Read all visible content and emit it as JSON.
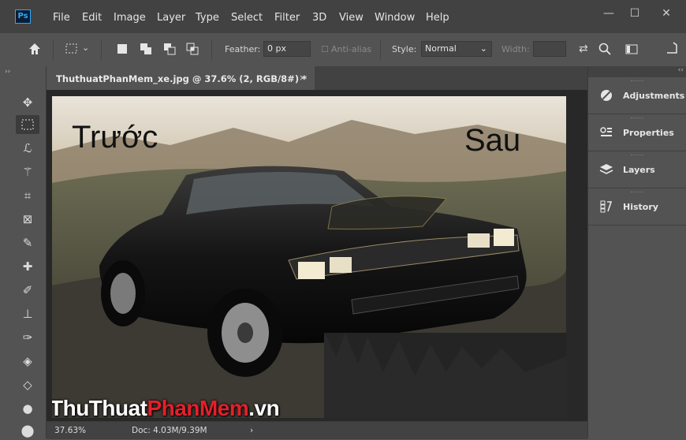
{
  "app": {
    "logo": "Ps"
  },
  "menu": [
    "File",
    "Edit",
    "Image",
    "Layer",
    "Type",
    "Select",
    "Filter",
    "3D",
    "View",
    "Window",
    "Help"
  ],
  "window_controls": {
    "minimize": "—",
    "restore": "☐",
    "close": "✕"
  },
  "options_bar": {
    "feather_label": "Feather:",
    "feather_value": "0 px",
    "antialias_label": "Anti-alias",
    "style_label": "Style:",
    "style_value": "Normal",
    "width_label": "Width:"
  },
  "document": {
    "tab_title": "ThuthuatPhanMem_xe.jpg @ 37.6% (2, RGB/8#) *",
    "close": "×"
  },
  "canvas": {
    "label_before": "Trước",
    "label_after": "Sau",
    "watermark_part1": "ThuThuat",
    "watermark_part2": "PhanMem",
    "watermark_part3": ".vn"
  },
  "status": {
    "zoom": "37.63%",
    "doc_size": "Doc: 4.03M/9.39M",
    "arrow": "›"
  },
  "panels": [
    {
      "label": "Adjustments",
      "icon": "adjustments-icon"
    },
    {
      "label": "Properties",
      "icon": "properties-icon"
    },
    {
      "label": "Layers",
      "icon": "layers-icon"
    },
    {
      "label": "History",
      "icon": "history-icon"
    }
  ],
  "colors": {
    "accent": "#31a8ff",
    "brand_red": "#e3202a",
    "ui_dark": "#424242",
    "ui_mid": "#535353"
  }
}
